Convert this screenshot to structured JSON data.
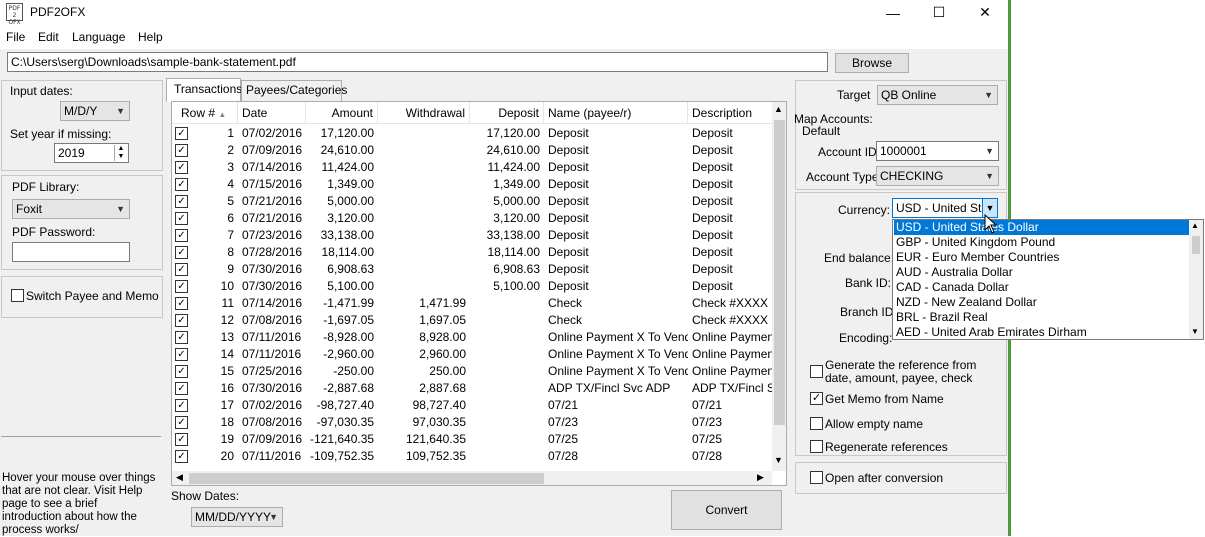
{
  "window": {
    "title": "PDF2OFX",
    "icon_text": "PDF2OFX",
    "minimize": "—",
    "maximize": "☐",
    "close": "✕"
  },
  "menu": [
    "File",
    "Edit",
    "Language",
    "Help"
  ],
  "file_path": "C:\\Users\\serg\\Downloads\\sample-bank-statement.pdf",
  "browse_label": "Browse",
  "left_panel": {
    "input_dates_label": "Input dates:",
    "input_dates_value": "M/D/Y",
    "set_year_label": "Set year if missing:",
    "year_value": "2019",
    "pdf_library_label": "PDF Library:",
    "pdf_library_value": "Foxit",
    "pdf_password_label": "PDF Password:",
    "pdf_password_value": "",
    "switch_payee_label": "Switch Payee and Memo",
    "help_text": "Hover your mouse over things that are not clear. Visit Help page to see a brief introduction about how the process works/"
  },
  "tabs": [
    "Transactions",
    "Payees/Categories"
  ],
  "table": {
    "headers": [
      "Row #",
      "Date",
      "Amount",
      "Withdrawal",
      "Deposit",
      "Name (payee/r)",
      "Description"
    ],
    "rows": [
      [
        "1",
        "07/02/2016",
        "17,120.00",
        "",
        "17,120.00",
        "Deposit",
        "Deposit"
      ],
      [
        "2",
        "07/09/2016",
        "24,610.00",
        "",
        "24,610.00",
        "Deposit",
        "Deposit"
      ],
      [
        "3",
        "07/14/2016",
        "11,424.00",
        "",
        "11,424.00",
        "Deposit",
        "Deposit"
      ],
      [
        "4",
        "07/15/2016",
        "1,349.00",
        "",
        "1,349.00",
        "Deposit",
        "Deposit"
      ],
      [
        "5",
        "07/21/2016",
        "5,000.00",
        "",
        "5,000.00",
        "Deposit",
        "Deposit"
      ],
      [
        "6",
        "07/21/2016",
        "3,120.00",
        "",
        "3,120.00",
        "Deposit",
        "Deposit"
      ],
      [
        "7",
        "07/23/2016",
        "33,138.00",
        "",
        "33,138.00",
        "Deposit",
        "Deposit"
      ],
      [
        "8",
        "07/28/2016",
        "18,114.00",
        "",
        "18,114.00",
        "Deposit",
        "Deposit"
      ],
      [
        "9",
        "07/30/2016",
        "6,908.63",
        "",
        "6,908.63",
        "Deposit",
        "Deposit"
      ],
      [
        "10",
        "07/30/2016",
        "5,100.00",
        "",
        "5,100.00",
        "Deposit",
        "Deposit"
      ],
      [
        "11",
        "07/14/2016",
        "-1,471.99",
        "1,471.99",
        "",
        "Check",
        "Check #XXXX"
      ],
      [
        "12",
        "07/08/2016",
        "-1,697.05",
        "1,697.05",
        "",
        "Check",
        "Check #XXXX"
      ],
      [
        "13",
        "07/11/2016",
        "-8,928.00",
        "8,928.00",
        "",
        "Online Payment X To Vendor",
        "Online Payment"
      ],
      [
        "14",
        "07/11/2016",
        "-2,960.00",
        "2,960.00",
        "",
        "Online Payment X To Vendor",
        "Online Payment"
      ],
      [
        "15",
        "07/25/2016",
        "-250.00",
        "250.00",
        "",
        "Online Payment X To Vendor",
        "Online Payment"
      ],
      [
        "16",
        "07/30/2016",
        "-2,887.68",
        "2,887.68",
        "",
        "ADP TX/Fincl Svc ADP",
        "ADP TX/Fincl Svc"
      ],
      [
        "17",
        "07/02/2016",
        "-98,727.40",
        "98,727.40",
        "",
        "07/21",
        "07/21"
      ],
      [
        "18",
        "07/08/2016",
        "-97,030.35",
        "97,030.35",
        "",
        "07/23",
        "07/23"
      ],
      [
        "19",
        "07/09/2016",
        "-121,640.35",
        "121,640.35",
        "",
        "07/25",
        "07/25"
      ],
      [
        "20",
        "07/11/2016",
        "-109,752.35",
        "109,752.35",
        "",
        "07/28",
        "07/28"
      ]
    ]
  },
  "show_dates_label": "Show Dates:",
  "show_dates_value": "MM/DD/YYYY",
  "convert_label": "Convert",
  "right_panel": {
    "target_label": "Target",
    "target_value": "QB Online",
    "map_accounts_label": "Map Accounts:",
    "default_label": "Default",
    "account_id_label": "Account ID:",
    "account_id_value": "1000001",
    "account_type_label": "Account Type:",
    "account_type_value": "CHECKING",
    "currency_label": "Currency:",
    "currency_value": "USD - United Sta",
    "end_balance_label": "End balance:",
    "bank_id_label": "Bank ID:",
    "branch_id_label": "Branch ID",
    "encoding_label": "Encoding:",
    "gen_ref_label": "Generate the reference from date, amount, payee, check",
    "get_memo_label": "Get Memo from Name",
    "allow_empty_label": "Allow empty name",
    "regen_label": "Regenerate references",
    "open_after_label": "Open after conversion"
  },
  "currency_options": [
    "USD - United States Dollar",
    "GBP - United Kingdom Pound",
    "EUR - Euro Member Countries",
    "AUD - Australia Dollar",
    "CAD - Canada Dollar",
    "NZD - New Zealand Dollar",
    "BRL - Brazil Real",
    "AED - United Arab Emirates Dirham"
  ],
  "colors": {
    "selection": "#0078d7",
    "window_accent": "#4e9a3a"
  }
}
